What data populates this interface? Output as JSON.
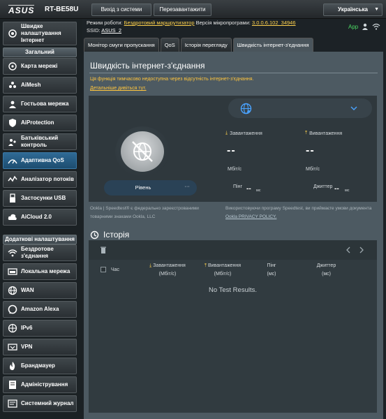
{
  "header": {
    "logo": "ASUS",
    "model": "RT-BE58U",
    "logout_label": "Вихід з системи",
    "reboot_label": "Перезавантажити",
    "language": "Українська"
  },
  "info": {
    "mode_label": "Режим роботи:",
    "mode_value": "Бездротовий маршрутизатор",
    "fw_label": "Версія мікропрограми:",
    "fw_value": "3.0.0.6.102_34946",
    "ssid_label": "SSID:",
    "ssid_value": "ASUS_2",
    "app_label": "App"
  },
  "sidebar": {
    "quick_setup": "Швидке налаштування Інтернет",
    "general_header": "Загальний",
    "general_items": [
      {
        "label": "Карта мережі",
        "icon": "network-map-icon"
      },
      {
        "label": "AiMesh",
        "icon": "aimesh-icon"
      },
      {
        "label": "Гостьова мережа",
        "icon": "guest-network-icon"
      },
      {
        "label": "AiProtection",
        "icon": "aiprotection-icon"
      },
      {
        "label": "Батьківський контроль",
        "icon": "parental-control-icon"
      },
      {
        "label": "Адаптивна QoS",
        "icon": "qos-icon"
      },
      {
        "label": "Аналізатор потоків",
        "icon": "traffic-analyzer-icon"
      },
      {
        "label": "Застосунки USB",
        "icon": "usb-icon"
      },
      {
        "label": "AiCloud 2.0",
        "icon": "aicloud-icon"
      }
    ],
    "advanced_header": "Додаткові налаштування",
    "advanced_items": [
      {
        "label": "Бездротове з'єднання",
        "icon": "wireless-icon"
      },
      {
        "label": "Локальна мережа",
        "icon": "lan-icon"
      },
      {
        "label": "WAN",
        "icon": "wan-icon"
      },
      {
        "label": "Amazon Alexa",
        "icon": "alexa-icon"
      },
      {
        "label": "IPv6",
        "icon": "ipv6-icon"
      },
      {
        "label": "VPN",
        "icon": "vpn-icon"
      },
      {
        "label": "Брандмауер",
        "icon": "firewall-icon"
      },
      {
        "label": "Адміністрування",
        "icon": "administration-icon"
      },
      {
        "label": "Системний журнал",
        "icon": "system-log-icon"
      }
    ]
  },
  "tabs": [
    "Монітор смуги пропускання",
    "QoS",
    "Історія перегляду",
    "Швидкість інтернет-з'єднання"
  ],
  "main": {
    "title": "Швидкість інтернет-з'єднання",
    "notice": "Ця функція тимчасово недоступна через відсутність інтернет-з'єднання.",
    "details_link": "Детальніше дивіться тут.",
    "download_label": "Завантаження",
    "upload_label": "Вивантаження",
    "download_value": "--",
    "upload_value": "--",
    "download_unit": "Мбіт/с",
    "upload_unit": "Мбіт/с",
    "level_label": "Рівень",
    "level_badge": "···",
    "ping_label": "Пінг",
    "ping_value": "--",
    "ping_unit": "мс",
    "jitter_label": "Джиттер",
    "jitter_value": "--",
    "jitter_unit": "мс",
    "legal_left_1": "Ookla | Speedtest® є федерально зареєстрованими",
    "legal_left_2": "товарними знаками Ookla, LLC",
    "legal_right_1": "Використовуючи програму Speedtest, ви приймаєте умови документа",
    "legal_right_2": "Ookla PRIVACY POLICY."
  },
  "history": {
    "title": "Історія",
    "col_time": "Час",
    "col_download": "Завантаження",
    "col_download_unit": "(Мбіт/с)",
    "col_upload": "Вивантаження",
    "col_upload_unit": "(Мбіт/с)",
    "col_ping": "Пінг",
    "col_ping_unit": "(мс)",
    "col_jitter": "Джиттер",
    "col_jitter_unit": "(мс)",
    "empty_text": "No Test Results."
  }
}
